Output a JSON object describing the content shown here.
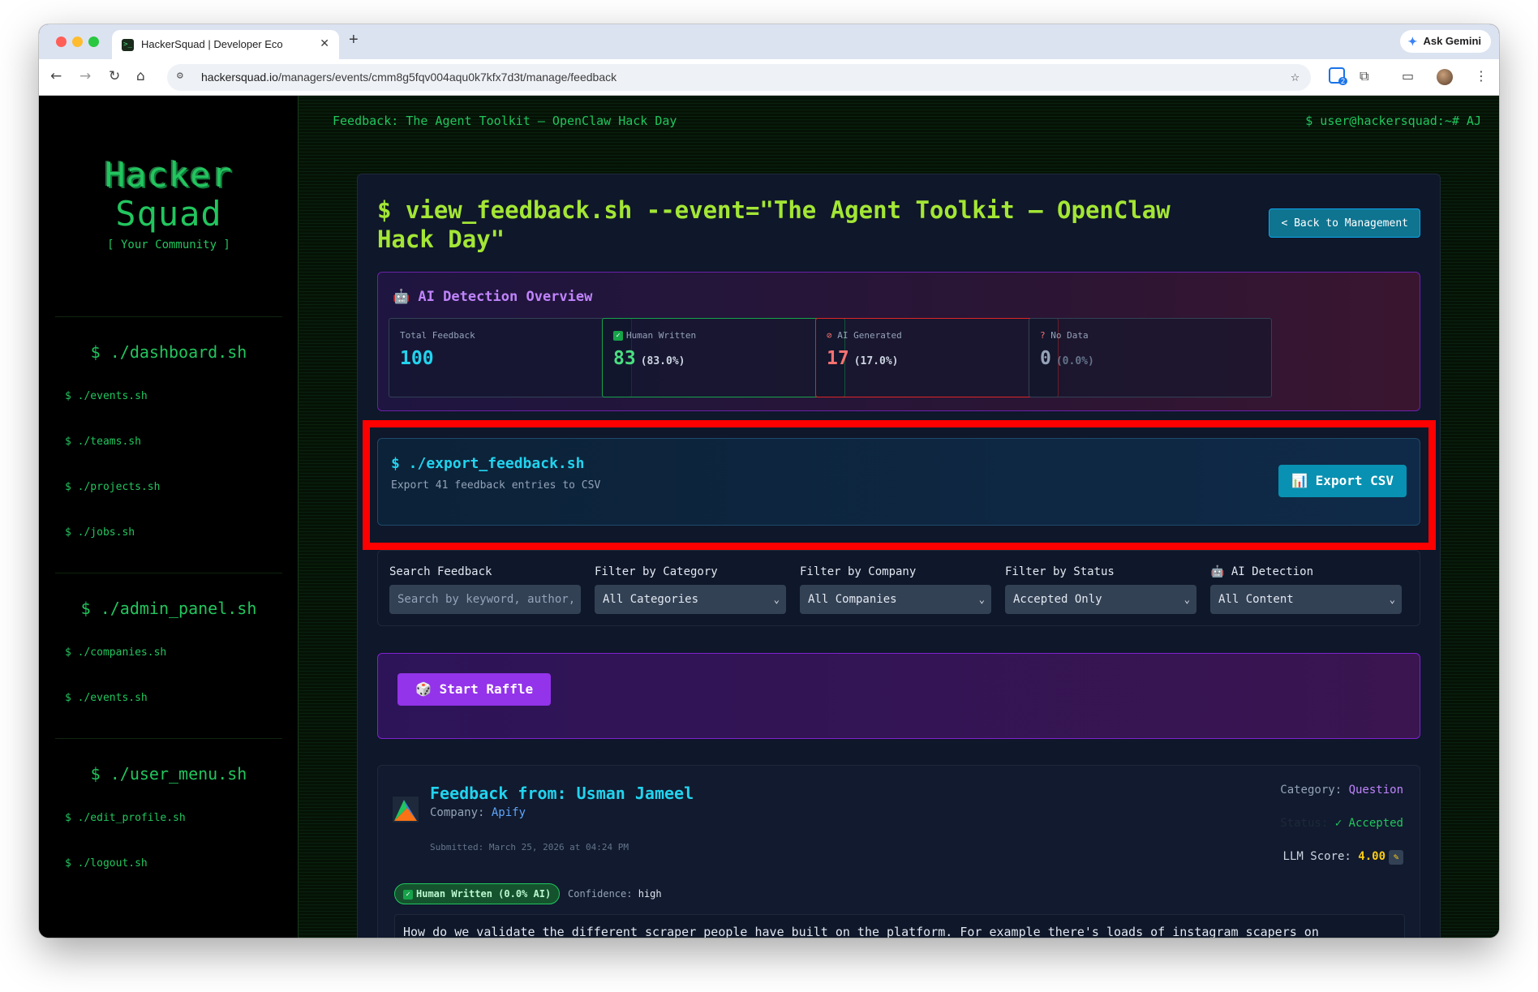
{
  "browser": {
    "tab_title": "HackerSquad | Developer Eco",
    "url_host": "hackersquad.io",
    "url_path": "/managers/events/cmm8g5fqv004aqu0k7kfx7d3t/manage/feedback",
    "gemini_label": "Ask Gemini",
    "extension_count": "2"
  },
  "sidebar": {
    "logo_line1": "Hacker",
    "logo_line2": "Squad",
    "logo_sub": "[ Your Community ]",
    "sections": [
      {
        "title": "$ ./dashboard.sh",
        "items": [
          "$ ./events.sh",
          "$ ./teams.sh",
          "$ ./projects.sh",
          "$ ./jobs.sh"
        ]
      },
      {
        "title": "$ ./admin_panel.sh",
        "items": [
          "$ ./companies.sh",
          "$ ./events.sh"
        ]
      },
      {
        "title": "$ ./user_menu.sh",
        "items": [
          "$ ./edit_profile.sh",
          "$ ./logout.sh"
        ]
      }
    ]
  },
  "topbar": {
    "left": "Feedback: The Agent Toolkit – OpenClaw Hack Day",
    "right": "$ user@hackersquad:~# AJ"
  },
  "header": {
    "title": "$ view_feedback.sh --event=\"The Agent Toolkit – OpenClaw Hack Day\"",
    "back_button": "< Back to Management"
  },
  "ai_overview": {
    "title": "AI Detection Overview",
    "stats": [
      {
        "label": "Total Feedback",
        "value": "100",
        "pct": "",
        "color": "#22d3ee"
      },
      {
        "label": "Human Written",
        "value": "83",
        "pct": "(83.0%)",
        "color": "#4ade80"
      },
      {
        "label": "AI Generated",
        "value": "17",
        "pct": "(17.0%)",
        "color": "#f87171"
      },
      {
        "label": "No Data",
        "value": "0",
        "pct": "(0.0%)",
        "color": "#94a3b8"
      }
    ]
  },
  "export": {
    "title": "$ ./export_feedback.sh",
    "subtitle": "Export 41 feedback entries to CSV",
    "button": "Export CSV"
  },
  "filters": {
    "search_label": "Search Feedback",
    "search_placeholder": "Search by keyword, author, ...",
    "category_label": "Filter by Category",
    "category_value": "All Categories",
    "company_label": "Filter by Company",
    "company_value": "All Companies",
    "status_label": "Filter by Status",
    "status_value": "Accepted Only",
    "ai_label": "AI Detection",
    "ai_value": "All Content"
  },
  "raffle": {
    "button": "Start Raffle"
  },
  "feedback": {
    "title": "Feedback from: Usman Jameel",
    "company_label": "Company:",
    "company": "Apify",
    "submitted": "Submitted: March 25, 2026 at 04:24 PM",
    "category_label": "Category:",
    "category": "Question",
    "status_label": "Status:",
    "status": "✓ Accepted",
    "score_label": "LLM Score:",
    "score": "4.00",
    "human_badge": "Human Written (0.0% AI)",
    "confidence_label": "Confidence:",
    "confidence": "high",
    "text": "How do we validate the different scraper people have built on the platform. For example there's loads of instagram scapers on"
  }
}
